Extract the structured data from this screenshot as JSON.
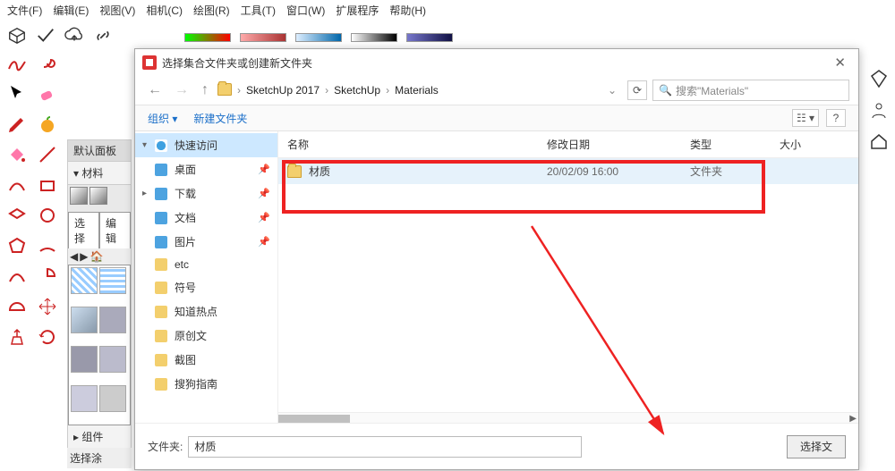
{
  "menu": [
    "文件(F)",
    "编辑(E)",
    "视图(V)",
    "相机(C)",
    "绘图(R)",
    "工具(T)",
    "窗口(W)",
    "扩展程序",
    "帮助(H)"
  ],
  "panel": {
    "title": "默认面板",
    "section": "▾ 材料",
    "tabs": [
      "选择",
      "编辑"
    ],
    "foot1": "▸ 组件",
    "status": "选择涂"
  },
  "dialog": {
    "title": "选择集合文件夹或创建新文件夹",
    "breadcrumbs": [
      "SketchUp 2017",
      "SketchUp",
      "Materials"
    ],
    "search_placeholder": "搜索\"Materials\"",
    "organize": "组织 ▾",
    "newfolder": "新建文件夹",
    "columns": {
      "name": "名称",
      "date": "修改日期",
      "type": "类型",
      "size": "大小"
    },
    "row": {
      "name": "材质",
      "date": "20/02/09 16:00",
      "type": "文件夹"
    },
    "folder_label": "文件夹:",
    "folder_value": "材质",
    "select_btn": "选择文",
    "sidebar": [
      {
        "label": "快速访问",
        "cls": "star",
        "active": true,
        "caret": "▾"
      },
      {
        "label": "桌面",
        "cls": "blue",
        "pin": true
      },
      {
        "label": "下载",
        "cls": "blue",
        "pin": true,
        "caret": "▸"
      },
      {
        "label": "文档",
        "cls": "blue",
        "pin": true
      },
      {
        "label": "图片",
        "cls": "blue",
        "pin": true
      },
      {
        "label": "etc",
        "cls": "yellow"
      },
      {
        "label": "符号",
        "cls": "yellow"
      },
      {
        "label": "知道热点",
        "cls": "yellow"
      },
      {
        "label": "原创文",
        "cls": "yellow"
      },
      {
        "label": "截图",
        "cls": "yellow"
      },
      {
        "label": "搜狗指南",
        "cls": "yellow"
      }
    ]
  }
}
